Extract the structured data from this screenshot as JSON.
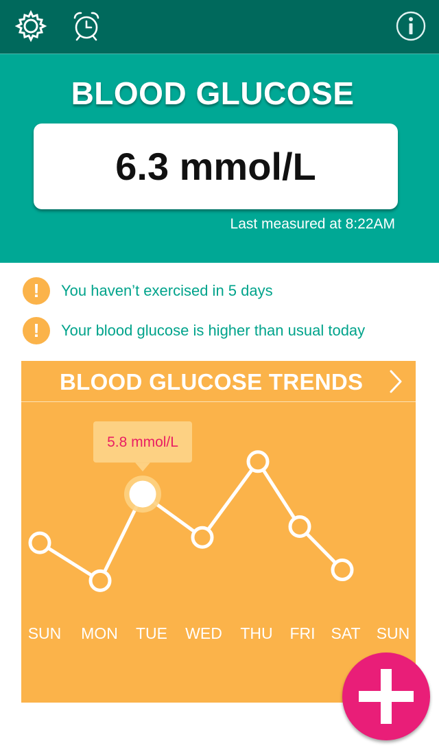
{
  "topbar": {
    "settings_icon": "gear-icon",
    "alarm_icon": "alarm-clock-icon",
    "info_icon": "info-icon"
  },
  "hero": {
    "title": "BLOOD GLUCOSE",
    "reading": "6.3 mmol/L",
    "last_measured": "Last measured at 8:22AM"
  },
  "alerts": [
    {
      "icon": "!",
      "text": "You haven’t exercised in 5 days"
    },
    {
      "icon": "!",
      "text": "Your blood glucose is higher than usual today"
    }
  ],
  "trends": {
    "title": "BLOOD GLUCOSE TRENDS",
    "tooltip": "5.8 mmol/L",
    "days": [
      "SUN",
      "MON",
      "TUE",
      "WED",
      "THU",
      "FRI",
      "SAT",
      "SUN"
    ]
  },
  "chart_data": {
    "type": "line",
    "title": "BLOOD GLUCOSE TRENDS",
    "categories": [
      "SUN",
      "MON",
      "TUE",
      "WED",
      "THU",
      "FRI",
      "SAT",
      "SUN"
    ],
    "series": [
      {
        "values": [
          4.9,
          4.2,
          5.8,
          5.0,
          6.4,
          5.2,
          4.4,
          null
        ]
      }
    ],
    "highlight_index": 2,
    "highlight_label": "5.8 mmol/L",
    "ylim": [
      3.0,
      7.5
    ],
    "grid": false,
    "colors": {
      "background": "#fbb34a",
      "line": "#ffffff",
      "tooltip_text": "#e91e63"
    }
  },
  "fab": {
    "icon": "plus-icon"
  }
}
